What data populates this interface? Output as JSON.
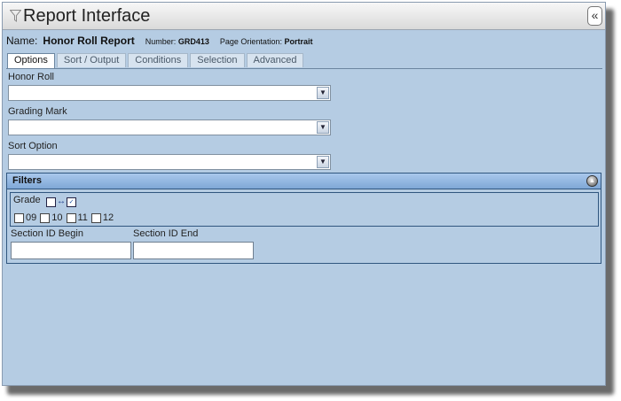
{
  "window": {
    "title": "Report Interface",
    "collapse_glyph": "«"
  },
  "report": {
    "name_label": "Name:",
    "name_value": "Honor Roll Report",
    "number_label": "Number:",
    "number_value": "GRD413",
    "orientation_label": "Page Orientation:",
    "orientation_value": "Portrait"
  },
  "tabs": [
    {
      "label": "Options",
      "active": true
    },
    {
      "label": "Sort / Output",
      "active": false
    },
    {
      "label": "Conditions",
      "active": false
    },
    {
      "label": "Selection",
      "active": false
    },
    {
      "label": "Advanced",
      "active": false
    }
  ],
  "fields": {
    "honor_roll": {
      "label": "Honor Roll",
      "value": ""
    },
    "grading_mark": {
      "label": "Grading Mark",
      "value": ""
    },
    "sort_option": {
      "label": "Sort Option",
      "value": ""
    }
  },
  "filters": {
    "title": "Filters",
    "grade_label": "Grade",
    "grades": [
      "09",
      "10",
      "11",
      "12"
    ],
    "section_begin_label": "Section ID Begin",
    "section_end_label": "Section ID End",
    "section_begin_value": "",
    "section_end_value": ""
  },
  "colors": {
    "panel_bg": "#b5cce3",
    "filters_header": "#7fa7d6",
    "border": "#30567f"
  },
  "icons": {
    "title_icon": "funnel-icon",
    "collapse": "double-chevron-left-icon",
    "filters_toggle": "collapse-circle-icon"
  }
}
